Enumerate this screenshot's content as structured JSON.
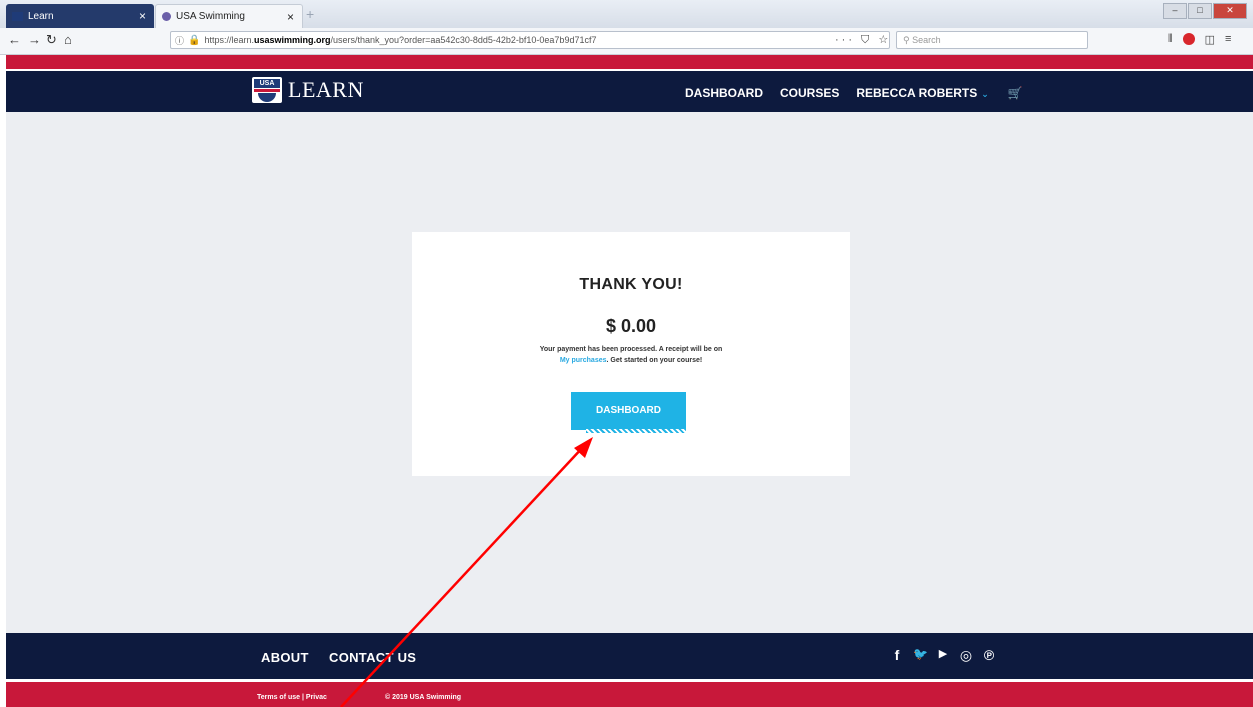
{
  "browser": {
    "tabs": [
      {
        "label": "Learn",
        "close": "×"
      },
      {
        "label": "USA Swimming",
        "close": "×"
      }
    ],
    "new_tab": "+",
    "nav": {
      "back": "←",
      "forward": "→",
      "reload": "↻",
      "home": "⌂"
    },
    "url": {
      "info": "ⓘ",
      "lock": "🔒",
      "prefix": "https://learn.",
      "host": "usaswimming.org",
      "path": "/users/thank_you?order=aa542c30-8dd5-42b2-bf10-0ea7b9d71cf7"
    },
    "url_actions": "··· ⛉ ☆",
    "search_placeholder": "Search",
    "toolbar_icons": {
      "library": "⫴",
      "sidebar": "◫",
      "menu": "≡"
    },
    "window_controls": {
      "minimize": "–",
      "maximize": "□",
      "close": "✕"
    }
  },
  "site": {
    "logo_mark_text": "USA",
    "logo_text": "LEARN",
    "nav": {
      "dashboard": "DASHBOARD",
      "courses": "COURSES",
      "user": "REBECCA ROBERTS",
      "chevron": "⌄",
      "cart": "🛒"
    }
  },
  "card": {
    "title": "THANK YOU!",
    "amount": "$ 0.00",
    "message_part1": "Your payment has been processed. A receipt will be on",
    "message_link": "My purchases",
    "message_part2": ". Get started on your course!",
    "button": "DASHBOARD"
  },
  "footer": {
    "about": "ABOUT",
    "contact": "CONTACT US",
    "social": {
      "facebook": "f",
      "twitter": "🐦",
      "youtube": "▶",
      "instagram": "◎",
      "pinterest": "℗"
    },
    "terms": "Terms of use | Privac",
    "copyright": "© 2019 USA Swimming"
  },
  "colors": {
    "navy": "#0d1a3e",
    "red": "#c8183a",
    "accent": "#1fb3e5",
    "background": "#eceef2",
    "annotation_arrow": "#ff0000"
  }
}
